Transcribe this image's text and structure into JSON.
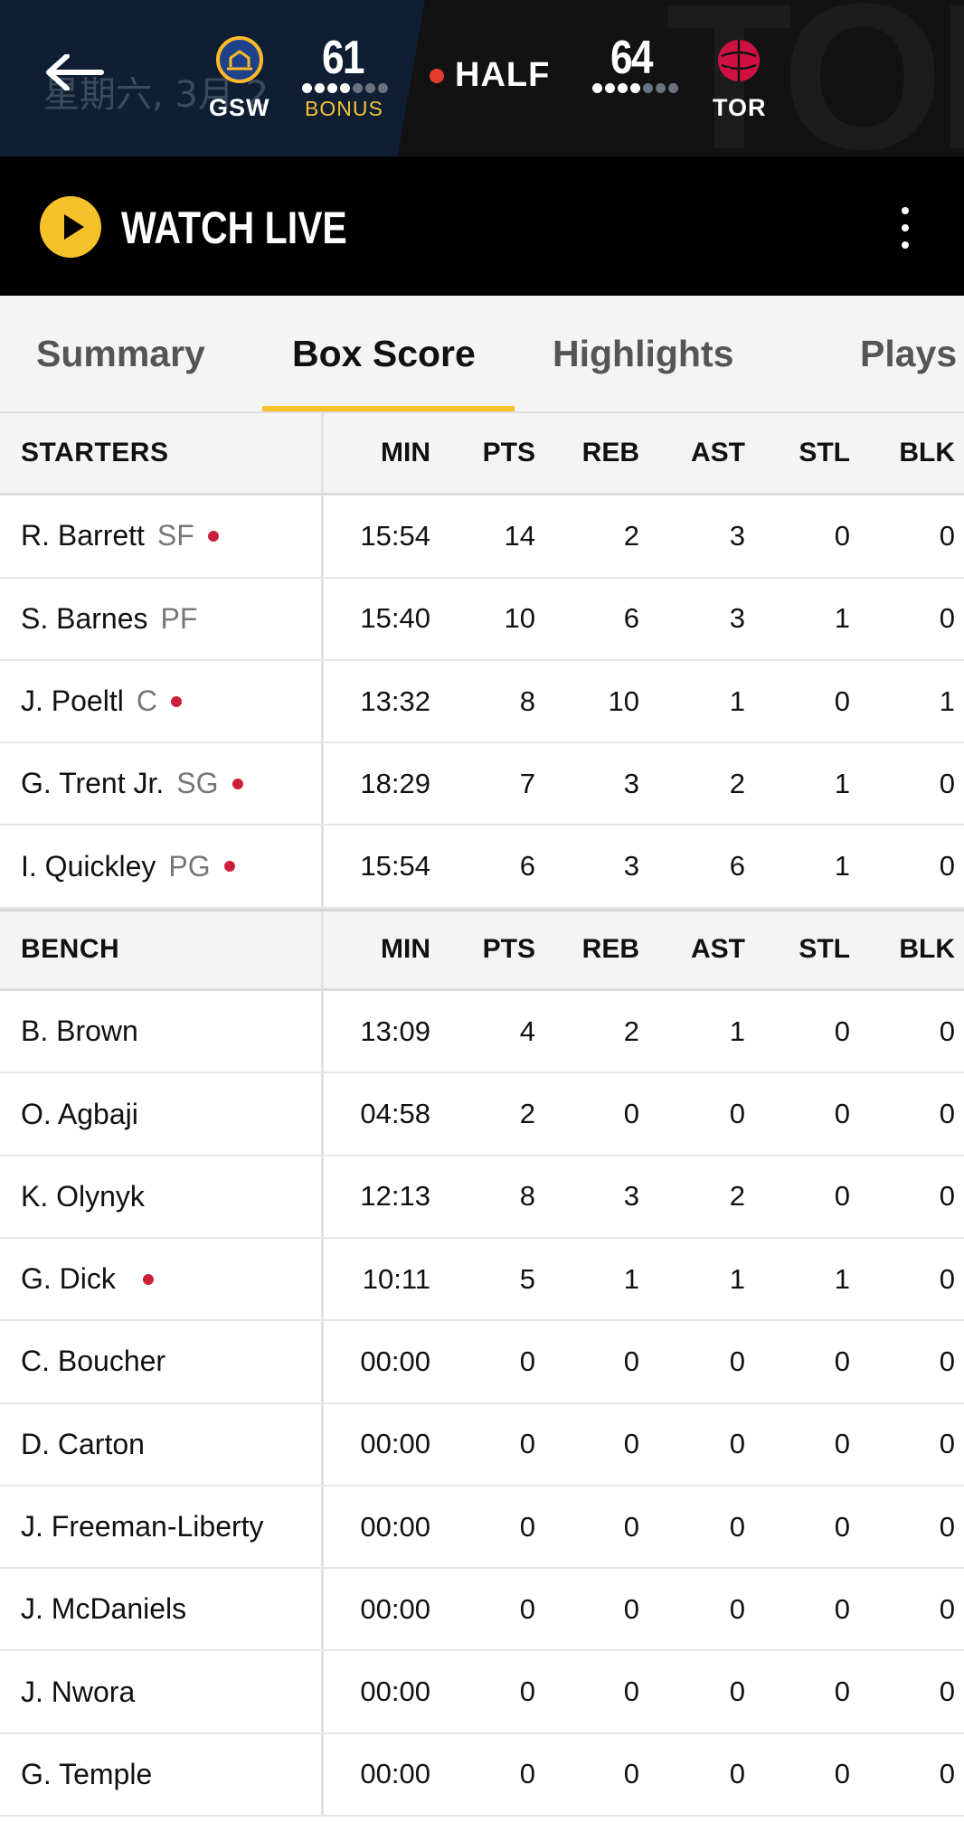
{
  "header": {
    "back_label": "back",
    "date_text": "星期六, 3月 2",
    "home_team": {
      "abbr": "GSW",
      "score": "61",
      "bonus": "BONUS",
      "timeouts_total": 7,
      "timeouts_remaining": 4
    },
    "away_team": {
      "abbr": "TOR",
      "score": "64",
      "timeouts_total": 7,
      "timeouts_remaining": 4
    },
    "status": "HALF",
    "background_letters": "TOR",
    "colors": {
      "header_bg": "#0f1e33",
      "bonus": "#f3c13a",
      "live_dot": "#e53b2e"
    }
  },
  "watch": {
    "label": "WATCH LIVE",
    "play_icon": "play-icon",
    "more_icon": "more-vertical-icon"
  },
  "tabs": [
    {
      "label": "Summary",
      "active": false
    },
    {
      "label": "Box Score",
      "active": true
    },
    {
      "label": "Highlights",
      "active": false
    },
    {
      "label": "Plays",
      "active": false
    }
  ],
  "columns": [
    "MIN",
    "PTS",
    "REB",
    "AST",
    "STL",
    "BLK"
  ],
  "starters": {
    "title": "STARTERS",
    "players": [
      {
        "name": "R. Barrett",
        "pos": "SF",
        "dot": true,
        "min": "15:54",
        "pts": "14",
        "reb": "2",
        "ast": "3",
        "stl": "0",
        "blk": "0"
      },
      {
        "name": "S. Barnes",
        "pos": "PF",
        "dot": false,
        "min": "15:40",
        "pts": "10",
        "reb": "6",
        "ast": "3",
        "stl": "1",
        "blk": "0"
      },
      {
        "name": "J. Poeltl",
        "pos": "C",
        "dot": true,
        "min": "13:32",
        "pts": "8",
        "reb": "10",
        "ast": "1",
        "stl": "0",
        "blk": "1"
      },
      {
        "name": "G. Trent Jr.",
        "pos": "SG",
        "dot": true,
        "min": "18:29",
        "pts": "7",
        "reb": "3",
        "ast": "2",
        "stl": "1",
        "blk": "0"
      },
      {
        "name": "I. Quickley",
        "pos": "PG",
        "dot": true,
        "min": "15:54",
        "pts": "6",
        "reb": "3",
        "ast": "6",
        "stl": "1",
        "blk": "0"
      }
    ]
  },
  "bench": {
    "title": "BENCH",
    "players": [
      {
        "name": "B. Brown",
        "pos": "",
        "dot": false,
        "min": "13:09",
        "pts": "4",
        "reb": "2",
        "ast": "1",
        "stl": "0",
        "blk": "0"
      },
      {
        "name": "O. Agbaji",
        "pos": "",
        "dot": false,
        "min": "04:58",
        "pts": "2",
        "reb": "0",
        "ast": "0",
        "stl": "0",
        "blk": "0"
      },
      {
        "name": "K. Olynyk",
        "pos": "",
        "dot": false,
        "min": "12:13",
        "pts": "8",
        "reb": "3",
        "ast": "2",
        "stl": "0",
        "blk": "0"
      },
      {
        "name": "G. Dick",
        "pos": "",
        "dot": true,
        "min": "10:11",
        "pts": "5",
        "reb": "1",
        "ast": "1",
        "stl": "1",
        "blk": "0"
      },
      {
        "name": "C. Boucher",
        "pos": "",
        "dot": false,
        "min": "00:00",
        "pts": "0",
        "reb": "0",
        "ast": "0",
        "stl": "0",
        "blk": "0"
      },
      {
        "name": "D. Carton",
        "pos": "",
        "dot": false,
        "min": "00:00",
        "pts": "0",
        "reb": "0",
        "ast": "0",
        "stl": "0",
        "blk": "0"
      },
      {
        "name": "J. Freeman-Liberty",
        "pos": "",
        "dot": false,
        "min": "00:00",
        "pts": "0",
        "reb": "0",
        "ast": "0",
        "stl": "0",
        "blk": "0"
      },
      {
        "name": "J. McDaniels",
        "pos": "",
        "dot": false,
        "min": "00:00",
        "pts": "0",
        "reb": "0",
        "ast": "0",
        "stl": "0",
        "blk": "0"
      },
      {
        "name": "J. Nwora",
        "pos": "",
        "dot": false,
        "min": "00:00",
        "pts": "0",
        "reb": "0",
        "ast": "0",
        "stl": "0",
        "blk": "0"
      },
      {
        "name": "G. Temple",
        "pos": "",
        "dot": false,
        "min": "00:00",
        "pts": "0",
        "reb": "0",
        "ast": "0",
        "stl": "0",
        "blk": "0"
      }
    ]
  }
}
